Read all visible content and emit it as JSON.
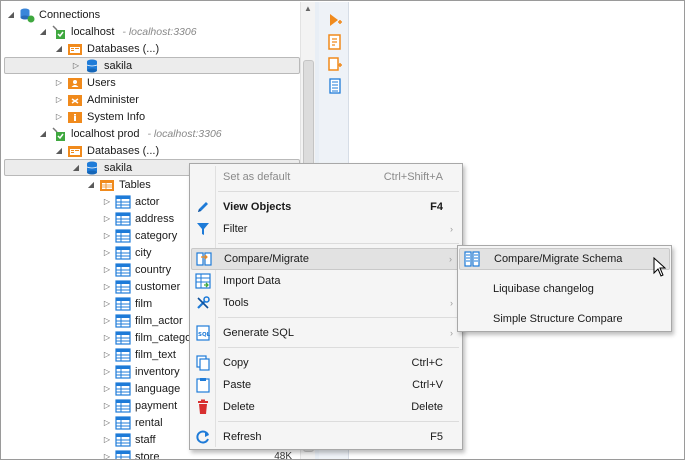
{
  "tree": {
    "root": {
      "label": "Connections"
    },
    "conn1": {
      "label": "localhost",
      "host": "- localhost:3306"
    },
    "conn1_dbs": {
      "label": "Databases (...)"
    },
    "conn1_sakila": {
      "label": "sakila"
    },
    "conn1_users": {
      "label": "Users"
    },
    "conn1_admin": {
      "label": "Administer"
    },
    "conn1_sysinfo": {
      "label": "System Info"
    },
    "conn2": {
      "label": "localhost prod",
      "host": "- localhost:3306"
    },
    "conn2_dbs": {
      "label": "Databases (...)"
    },
    "conn2_sakila": {
      "label": "sakila"
    },
    "tables": {
      "label": "Tables"
    },
    "table_items": [
      "actor",
      "address",
      "category",
      "city",
      "country",
      "customer",
      "film",
      "film_actor",
      "film_catego",
      "film_text",
      "inventory",
      "language",
      "payment",
      "rental",
      "staff",
      "store"
    ],
    "last_size": "48K"
  },
  "menu": {
    "set_default": {
      "label": "Set as default",
      "shortcut": "Ctrl+Shift+A"
    },
    "view_objects": {
      "label": "View  Objects",
      "shortcut": "F4"
    },
    "filter": {
      "label": "Filter"
    },
    "compare_migrate": {
      "label": "Compare/Migrate"
    },
    "import_data": {
      "label": "Import Data"
    },
    "tools": {
      "label": "Tools"
    },
    "generate_sql": {
      "label": "Generate SQL"
    },
    "copy": {
      "label": "Copy",
      "shortcut": "Ctrl+C"
    },
    "paste": {
      "label": "Paste",
      "shortcut": "Ctrl+V"
    },
    "delete": {
      "label": "Delete",
      "shortcut": "Delete"
    },
    "refresh": {
      "label": "Refresh",
      "shortcut": "F5"
    }
  },
  "submenu": {
    "compare_schema": {
      "label": "Compare/Migrate Schema"
    },
    "liquibase": {
      "label": "Liquibase changelog"
    },
    "simple_compare": {
      "label": "Simple Structure Compare"
    }
  },
  "colors": {
    "accent_blue": "#1e7bd8",
    "folder_orange": "#f08a1c",
    "selection_gray": "#e2e2e2",
    "delete_red": "#d83030"
  }
}
